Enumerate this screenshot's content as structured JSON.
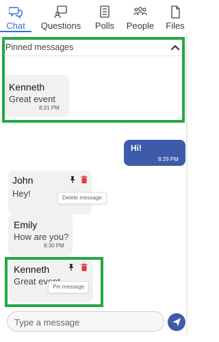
{
  "tabs": [
    {
      "label": "Chat",
      "icon": "chat-bubbles-icon",
      "active": true
    },
    {
      "label": "Questions",
      "icon": "question-board-icon",
      "active": false
    },
    {
      "label": "Polls",
      "icon": "poll-list-icon",
      "active": false
    },
    {
      "label": "People",
      "icon": "people-icon",
      "active": false
    },
    {
      "label": "Files",
      "icon": "file-icon",
      "active": false
    }
  ],
  "pinned": {
    "title": "Pinned messages",
    "toggle_icon": "chevron-up-icon",
    "message": {
      "name": "Kenneth",
      "text": "Great event",
      "time": "8:31 PM"
    }
  },
  "messages": [
    {
      "id": "mine",
      "text": "Hi!",
      "time": "8:29 PM",
      "color": "#3d5ba9"
    },
    {
      "id": "john",
      "name": "John",
      "text": "Hey!",
      "tooltip": "Delete message"
    },
    {
      "id": "emily",
      "name": "Emily",
      "text": "How are you?",
      "time": "8:30 PM"
    },
    {
      "id": "kenneth",
      "name": "Kenneth",
      "text": "Great event",
      "tooltip": "Pin message"
    }
  ],
  "composer": {
    "placeholder": "Type a message",
    "send_icon": "send-icon"
  },
  "colors": {
    "accent": "#2f6fd6",
    "highlight": "#22a744",
    "delete": "#e53935",
    "own_bubble": "#3d5ba9"
  }
}
